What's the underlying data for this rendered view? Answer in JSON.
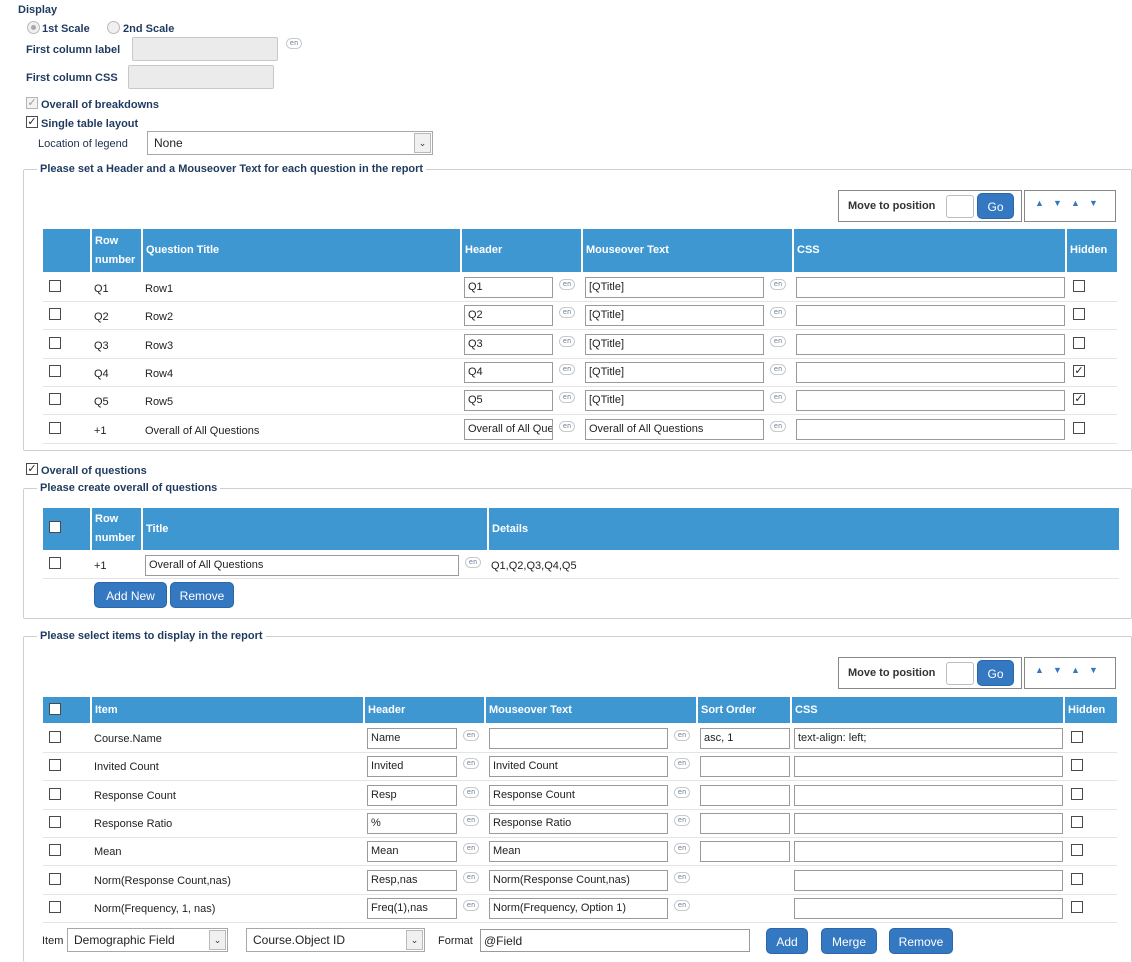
{
  "display": {
    "section_label": "Display",
    "scale1": "1st Scale",
    "scale2": "2nd Scale",
    "first_col_label": "First column label",
    "first_col_css": "First column CSS",
    "overall_breakdowns": "Overall of breakdowns",
    "single_table": "Single table layout",
    "legend_loc_label": "Location of legend",
    "legend_loc_value": "None",
    "lang": "en"
  },
  "questions": {
    "legend": "Please set a Header and a Mouseover Text for each question in the report",
    "move_label": "Move to position",
    "go": "Go",
    "columns": [
      "Row number",
      "Question Title",
      "Header",
      "Mouseover Text",
      "CSS",
      "Hidden"
    ],
    "col_row_1": "Row",
    "col_row_2": "number",
    "rows": [
      {
        "num": "Q1",
        "title": "Row1",
        "header": "Q1",
        "mouseover": "[QTitle]",
        "css": "",
        "hidden": false
      },
      {
        "num": "Q2",
        "title": "Row2",
        "header": "Q2",
        "mouseover": "[QTitle]",
        "css": "",
        "hidden": false
      },
      {
        "num": "Q3",
        "title": "Row3",
        "header": "Q3",
        "mouseover": "[QTitle]",
        "css": "",
        "hidden": false
      },
      {
        "num": "Q4",
        "title": "Row4",
        "header": "Q4",
        "mouseover": "[QTitle]",
        "css": "",
        "hidden": true
      },
      {
        "num": "Q5",
        "title": "Row5",
        "header": "Q5",
        "mouseover": "[QTitle]",
        "css": "",
        "hidden": true
      },
      {
        "num": "+1",
        "title": "Overall of All Questions",
        "header": "Overall of All Que",
        "mouseover": "Overall of All Questions",
        "css": "",
        "hidden": false
      }
    ]
  },
  "overall": {
    "checkbox_label": "Overall of questions",
    "legend": "Please create overall of questions",
    "columns": [
      "Row number",
      "Title",
      "Details"
    ],
    "row": {
      "num": "+1",
      "title": "Overall of All Questions",
      "details": "Q1,Q2,Q3,Q4,Q5"
    },
    "add_new": "Add New",
    "remove": "Remove"
  },
  "items": {
    "legend": "Please select items to display in the report",
    "move_label": "Move to position",
    "go": "Go",
    "columns": [
      "Item",
      "Header",
      "Mouseover Text",
      "Sort Order",
      "CSS",
      "Hidden"
    ],
    "rows": [
      {
        "item": "Course.Name",
        "header": "Name",
        "mouseover": "",
        "sort": "asc, 1",
        "css": "text-align: left;",
        "has_sort": true
      },
      {
        "item": "Invited Count",
        "header": "Invited",
        "mouseover": "Invited Count",
        "sort": "",
        "css": "",
        "has_sort": true
      },
      {
        "item": "Response Count",
        "header": "Resp",
        "mouseover": "Response Count",
        "sort": "",
        "css": "",
        "has_sort": true
      },
      {
        "item": "Response Ratio",
        "header": "%",
        "mouseover": "Response Ratio",
        "sort": "",
        "css": "",
        "has_sort": true
      },
      {
        "item": "Mean",
        "header": "Mean",
        "mouseover": "Mean",
        "sort": "",
        "css": "",
        "has_sort": true
      },
      {
        "item": "Norm(Response Count,nas)",
        "header": "Resp,nas",
        "mouseover": "Norm(Response Count,nas)",
        "sort": "",
        "css": "",
        "has_sort": false
      },
      {
        "item": "Norm(Frequency, 1, nas)",
        "header": "Freq(1),nas",
        "mouseover": "Norm(Frequency, Option 1)",
        "sort": "",
        "css": "",
        "has_sort": false
      }
    ]
  },
  "footer": {
    "item_label": "Item",
    "item_value": "Demographic Field",
    "field_value": "Course.Object ID",
    "format_label": "Format",
    "format_value": "@Field",
    "add": "Add",
    "merge": "Merge",
    "remove": "Remove"
  },
  "colors": {
    "header_blue": "#3f97d2",
    "button_blue": "#3478c1"
  }
}
